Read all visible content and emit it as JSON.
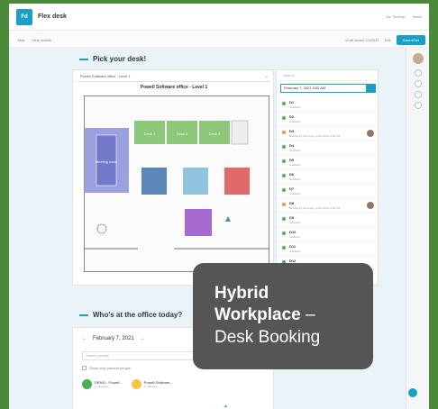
{
  "header": {
    "logo_text": "Fd",
    "app_title": "Flex desk",
    "links": [
      "My Timetrip",
      "Share"
    ]
  },
  "subbar": {
    "left": [
      "Map",
      "Help details"
    ],
    "right_text": "Draft saved 2/3/2021",
    "edit_label": "Edit",
    "saved_label": "Saved/Set"
  },
  "pick": {
    "title": "Pick your desk!",
    "floor_select": "Powell Software office - Level 1",
    "floor_name": "Powell Software office - Level 1",
    "room_labels": {
      "meeting": "Meeting room",
      "desk1": "Desk 1",
      "desk2": "Desk 2",
      "desk3": "Desk 3"
    }
  },
  "desk_list": {
    "search_placeholder": "Search",
    "date_value": "February 7, 2021 9:00 AM",
    "rows": [
      {
        "name": "D1",
        "sub": "Available",
        "status": "green",
        "avatar": false
      },
      {
        "name": "D2",
        "sub": "Available",
        "status": "green",
        "avatar": false
      },
      {
        "name": "D3",
        "sub": "Booked by John Doe, 02/07/2021 9:00 AM",
        "status": "orange",
        "avatar": true
      },
      {
        "name": "D4",
        "sub": "Available",
        "status": "green",
        "avatar": false
      },
      {
        "name": "D5",
        "sub": "Available",
        "status": "green",
        "avatar": false
      },
      {
        "name": "D6",
        "sub": "Available",
        "status": "green",
        "avatar": false
      },
      {
        "name": "D7",
        "sub": "Available",
        "status": "green",
        "avatar": false
      },
      {
        "name": "D8",
        "sub": "Booked by Jane Roe, 02/07/2021 9:00 AM",
        "status": "orange",
        "avatar": true
      },
      {
        "name": "D9",
        "sub": "Available",
        "status": "green",
        "avatar": false
      },
      {
        "name": "D10",
        "sub": "Available",
        "status": "green",
        "avatar": false
      },
      {
        "name": "D11",
        "sub": "Available",
        "status": "green",
        "avatar": false
      },
      {
        "name": "D12",
        "sub": "Available",
        "status": "green",
        "avatar": false
      },
      {
        "name": "D13",
        "sub": "Available",
        "status": "green",
        "avatar": false
      }
    ]
  },
  "who": {
    "title": "Who's at the office today?",
    "date": "February 7, 2021",
    "search_placeholder": "Search people",
    "checkbox_label": "Show only present people",
    "people": [
      {
        "name": "DEMO - Powell...",
        "sub": "1 colleague"
      },
      {
        "name": "Powell Software...",
        "sub": "1 colleague"
      }
    ]
  },
  "overlay": {
    "line1": "Hybrid",
    "line2_bold": "Workplace",
    "line2_rest": " –",
    "line3": "Desk Booking"
  },
  "colors": {
    "accent": "#1aa0c6",
    "available": "#4caf50",
    "booked": "#f39c12",
    "background": "#4a8a3a"
  }
}
